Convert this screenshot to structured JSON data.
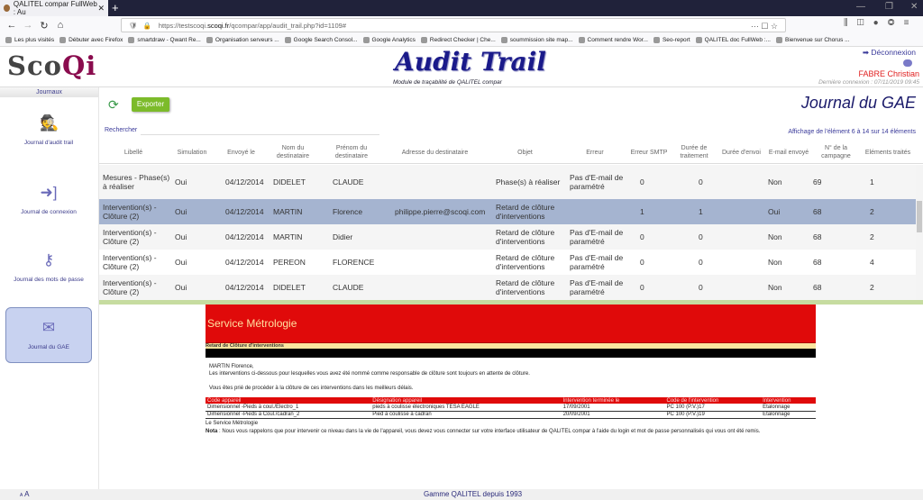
{
  "browser": {
    "tab_title": "QALITEL compar FullWeb : Au",
    "url_prefix": "https://testscoqi.",
    "url_domain": "scoqi.fr",
    "url_path": "/qcompar/app/audit_trail.php?id=1109#",
    "bookmarks": [
      "Les plus visités",
      "Débuter avec Firefox",
      "smartdraw - Qwant Re...",
      "Organisation serveurs ...",
      "Google Search Consol...",
      "Google Analytics",
      "Redirect Checker | Che...",
      "soummission site map...",
      "Comment rendre Wor...",
      "Seo-report",
      "QALITEL doc FullWeb :...",
      "Bienvenue sur Chorus ..."
    ]
  },
  "header": {
    "logo_main": "Sco",
    "logo_accent": "Qi",
    "app_title": "Audit Trail",
    "app_subtitle": "Module de traçabilité de QALITEL compar",
    "logout_label": "Déconnexion",
    "user_name": "FABRE Christian",
    "last_connection": "Dernière connexion : 07/11/2019 09:45"
  },
  "sidebar": {
    "title": "Journaux",
    "items": [
      {
        "label": "Journal d'audit trail",
        "icon": "spy-icon",
        "active": false
      },
      {
        "label": "Journal de connexion",
        "icon": "sign-in-icon",
        "active": false
      },
      {
        "label": "Journal des mots de passe",
        "icon": "key-icon",
        "active": false
      },
      {
        "label": "Journal du GAE",
        "icon": "envelope-icon",
        "active": true
      }
    ]
  },
  "main": {
    "export_label": "Exporter",
    "page_title": "Journal du GAE",
    "search_label": "Rechercher",
    "search_value": "",
    "count_text": "Affichage de l'élément 6 à 14 sur 14 éléments",
    "columns": [
      "Libellé",
      "Simulation",
      "Envoyé le",
      "Nom du destinataire",
      "Prénom du destinataire",
      "Adresse du destinataire",
      "Objet",
      "Erreur",
      "Erreur SMTP",
      "Durée de traitement",
      "Durée d'envoi",
      "E-mail envoyé",
      "N° de la campagne",
      "Eléments traités"
    ],
    "rows": [
      {
        "c": [
          "Mesures - Phase(s) à réaliser",
          "Oui",
          "04/12/2014",
          "DIDELET",
          "CLAUDE",
          "",
          "Phase(s) à réaliser",
          "Pas d'E-mail de paramétré",
          "0",
          "0",
          "Non",
          "69",
          "1"
        ],
        "selected": false
      },
      {
        "c": [
          "Intervention(s) - Clôture (2)",
          "Oui",
          "04/12/2014",
          "MARTIN",
          "Florence",
          "philippe.pierre@scoqi.com",
          "Retard de clôture d'interventions",
          "",
          "1",
          "1",
          "Oui",
          "68",
          "2"
        ],
        "selected": true
      },
      {
        "c": [
          "Intervention(s) - Clôture (2)",
          "Oui",
          "04/12/2014",
          "MARTIN",
          "Didier",
          "",
          "Retard de clôture d'interventions",
          "Pas d'E-mail de paramétré",
          "0",
          "0",
          "Non",
          "68",
          "2"
        ],
        "selected": false
      },
      {
        "c": [
          "Intervention(s) - Clôture (2)",
          "Oui",
          "04/12/2014",
          "PEREON",
          "FLORENCE",
          "",
          "Retard de clôture d'interventions",
          "Pas d'E-mail de paramétré",
          "0",
          "0",
          "Non",
          "68",
          "4"
        ],
        "selected": false
      },
      {
        "c": [
          "Intervention(s) - Clôture (2)",
          "Oui",
          "04/12/2014",
          "DIDELET",
          "CLAUDE",
          "",
          "Retard de clôture d'interventions",
          "Pas d'E-mail de paramétré",
          "0",
          "0",
          "Non",
          "68",
          "2"
        ],
        "selected": false
      }
    ]
  },
  "email": {
    "service": "Service Métrologie",
    "subject": "Retard de Clôture d'interventions",
    "greeting": "MARTIN Florence,",
    "line1": "Les interventions ci-dessous pour lesquelles vous avez été nommé comme responsable de clôture sont toujours en attente de clôture.",
    "line2": "Vous êtes prié de procéder à la clôture de ces interventions dans les meilleurs délais.",
    "table_headers": [
      "Code appareil",
      "Désignation appareil",
      "Intervention terminée le",
      "Code de l'intervention",
      "Intervention"
    ],
    "table_rows": [
      [
        "Dimensionnel -Pieds à coul./Electro_1",
        "pieds à coulisse électroniques TESA EAGLE",
        "17/09/2001",
        "PC 100 (P.V.)17",
        "Etalonnage"
      ],
      [
        "Dimensionnel -Pieds à Coul./cadran_2",
        "Pied à coulisse à cadran",
        "20/09/2001",
        "PC 100 (P.V.)19",
        "Etalonnage"
      ]
    ],
    "signature": "Le Service Métrologie",
    "nota_label": "Nota",
    "nota_text": " : Nous vous rappelons que pour intervenir ce niveau dans la vie de l'appareil, vous devez vous connecter sur votre interface utilisateur de QALITEL compar à l'aide du login et mot de passe personnalisés qui vous ont été remis."
  },
  "footer": {
    "text": "Gamme QALITEL depuis 1993",
    "font_small": "A",
    "font_large": "A"
  }
}
